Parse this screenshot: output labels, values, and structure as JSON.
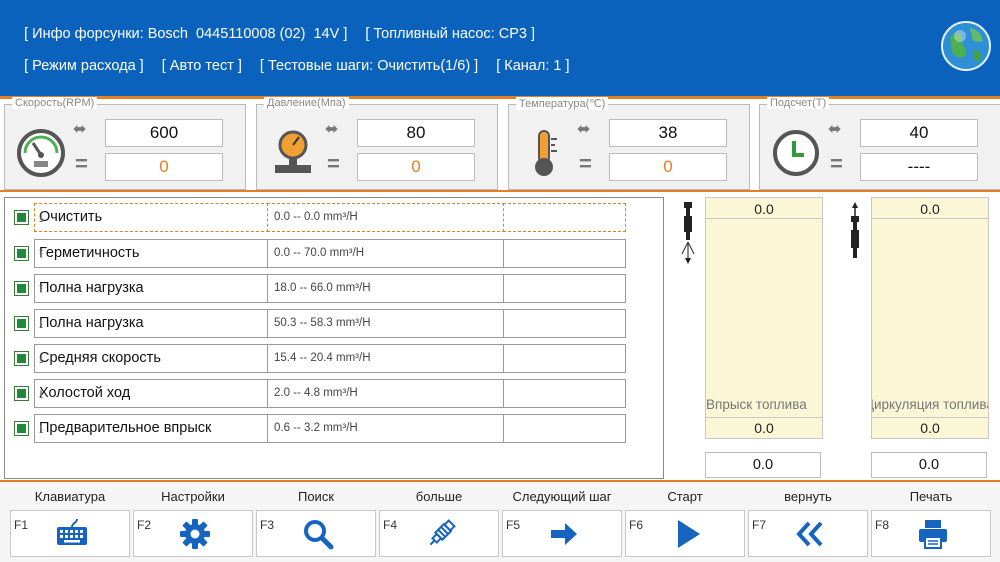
{
  "header": {
    "injector_info": "[ Инфо форсунки: Bosch  0445110008 (02)  14V ]",
    "pump_info": "[ Топливный насос: CP3 ]",
    "mode": "[ Режим расхода ]",
    "auto_test": "[ Авто тест ]",
    "test_steps": "[ Тестовые шаги: Очистить(1/6) ]",
    "channel": "[ Канал: 1 ]"
  },
  "gauges": [
    {
      "label": "Скорость(RPM)",
      "set": "600",
      "actual": "0",
      "icon": "speedometer-icon"
    },
    {
      "label": "Давление(Мпа)",
      "set": "80",
      "actual": "0",
      "icon": "pressure-gauge-icon"
    },
    {
      "label": "Температура(℃)",
      "set": "38",
      "actual": "0",
      "icon": "thermometer-icon"
    },
    {
      "label": "Подсчет(T)",
      "set": "40",
      "actual": "----",
      "icon": "clock-icon"
    }
  ],
  "steps": [
    {
      "name": "Очистить",
      "range": "0.0 -- 0.0 mm³/H",
      "result": ""
    },
    {
      "name": "Герметичность",
      "range": "0.0 -- 70.0 mm³/H",
      "result": ""
    },
    {
      "name": "Полна нагрузка",
      "range": "18.0 -- 66.0 mm³/H",
      "result": ""
    },
    {
      "name": "Полна нагрузка",
      "range": "50.3 -- 58.3 mm³/H",
      "result": ""
    },
    {
      "name": "Средняя скорость",
      "range": "15.4 -- 20.4 mm³/H",
      "result": ""
    },
    {
      "name": "Холостой ход",
      "range": "2.0 -- 4.8 mm³/H",
      "result": ""
    },
    {
      "name": "Предварительное впрыск",
      "range": "0.6 -- 3.2 mm³/H",
      "result": ""
    }
  ],
  "injection": {
    "top": "0.0",
    "bottom": "0.0",
    "caption": "Впрыск топлива",
    "result": "0.0"
  },
  "return": {
    "top": "0.0",
    "bottom": "0.0",
    "caption": "Циркуляция топлива",
    "result": "0.0"
  },
  "fkeys": [
    {
      "label": "Клавиатура",
      "key": "F1",
      "icon": "keyboard-icon"
    },
    {
      "label": "Настройки",
      "key": "F2",
      "icon": "gear-icon"
    },
    {
      "label": "Поиск",
      "key": "F3",
      "icon": "search-icon"
    },
    {
      "label": "больше",
      "key": "F4",
      "icon": "injector-icon"
    },
    {
      "label": "Следующий шаг",
      "key": "F5",
      "icon": "arrow-right-icon"
    },
    {
      "label": "Старт",
      "key": "F6",
      "icon": "play-icon"
    },
    {
      "label": "вернуть",
      "key": "F7",
      "icon": "double-chevron-left-icon"
    },
    {
      "label": "Печать",
      "key": "F8",
      "icon": "printer-icon"
    }
  ],
  "colors": {
    "header": "#0a62bd",
    "accent": "#e67e22",
    "icon_blue": "#1565c0",
    "check_green": "#1f8a3a"
  }
}
